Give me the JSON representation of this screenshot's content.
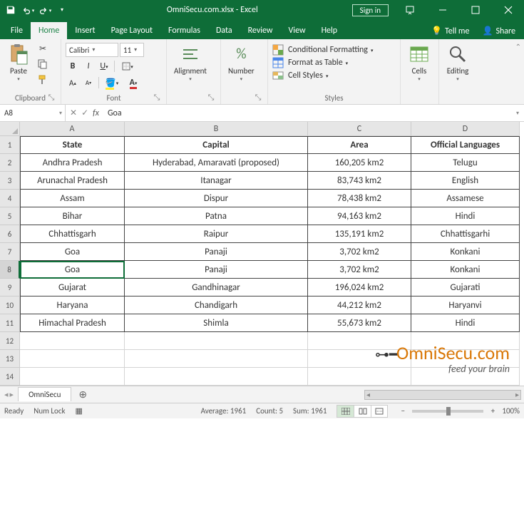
{
  "title": "OmniSecu.com.xlsx - Excel",
  "signin": "Sign in",
  "menu_tabs": [
    "File",
    "Home",
    "Insert",
    "Page Layout",
    "Formulas",
    "Data",
    "Review",
    "View",
    "Help"
  ],
  "tellme": "Tell me",
  "share": "Share",
  "ribbon": {
    "clipboard": {
      "paste": "Paste",
      "label": "Clipboard"
    },
    "font": {
      "name": "Calibri",
      "size": "11",
      "label": "Font"
    },
    "alignment": {
      "label": "Alignment"
    },
    "number": {
      "label": "Number"
    },
    "styles": {
      "cond": "Conditional Formatting",
      "table": "Format as Table",
      "cellstyles": "Cell Styles",
      "label": "Styles"
    },
    "cells": {
      "label": "Cells"
    },
    "editing": {
      "label": "Editing"
    }
  },
  "namebox": "A8",
  "formula": "Goa",
  "columns": [
    "A",
    "B",
    "C",
    "D"
  ],
  "headers": {
    "state": "State",
    "capital": "Capital",
    "area": "Area",
    "lang": "Official Languages"
  },
  "rows": [
    {
      "state": "Andhra Pradesh",
      "capital": "Hyderabad, Amaravati (proposed)",
      "area": "160,205 km2",
      "lang": "Telugu"
    },
    {
      "state": "Arunachal Pradesh",
      "capital": "Itanagar",
      "area": "83,743 km2",
      "lang": "English"
    },
    {
      "state": "Assam",
      "capital": "Dispur",
      "area": "78,438 km2",
      "lang": "Assamese"
    },
    {
      "state": "Bihar",
      "capital": "Patna",
      "area": "94,163 km2",
      "lang": "Hindi"
    },
    {
      "state": "Chhattisgarh",
      "capital": "Raipur",
      "area": "135,191 km2",
      "lang": "Chhattisgarhi"
    },
    {
      "state": "Goa",
      "capital": "Panaji",
      "area": "3,702 km2",
      "lang": "Konkani"
    },
    {
      "state": "Goa",
      "capital": "Panaji",
      "area": "3,702 km2",
      "lang": "Konkani"
    },
    {
      "state": "Gujarat",
      "capital": "Gandhinagar",
      "area": "196,024 km2",
      "lang": "Gujarati"
    },
    {
      "state": "Haryana",
      "capital": "Chandigarh",
      "area": "44,212 km2",
      "lang": "Haryanvi"
    },
    {
      "state": "Himachal Pradesh",
      "capital": "Shimla",
      "area": "55,673 km2",
      "lang": "Hindi"
    }
  ],
  "selected_row_index": 6,
  "empty_rows": 3,
  "sheet": "OmniSecu",
  "status": {
    "ready": "Ready",
    "numlock": "Num Lock",
    "average": "Average: 1961",
    "count": "Count: 5",
    "sum": "Sum: 1961",
    "zoom": "100%"
  },
  "watermark": {
    "main": "OmniSecu.com",
    "sub": "feed your brain"
  }
}
